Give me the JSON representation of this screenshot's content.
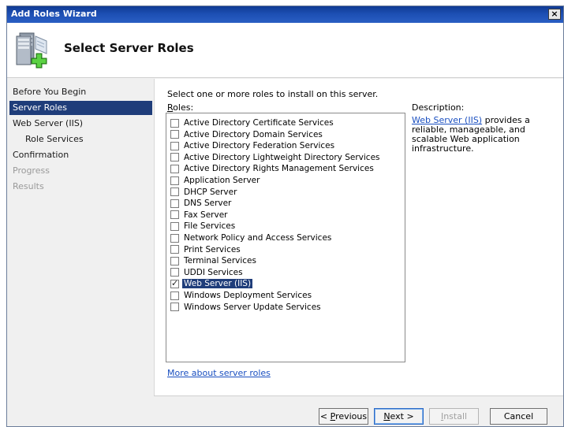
{
  "window": {
    "title": "Add Roles Wizard",
    "close_glyph": "×"
  },
  "header": {
    "title": "Select Server Roles",
    "icon": "server-add-icon"
  },
  "nav": {
    "items": [
      {
        "label": "Before You Begin",
        "state": "normal"
      },
      {
        "label": "Server Roles",
        "state": "active"
      },
      {
        "label": "Web Server (IIS)",
        "state": "normal"
      },
      {
        "label": "Role Services",
        "state": "sub"
      },
      {
        "label": "Confirmation",
        "state": "normal"
      },
      {
        "label": "Progress",
        "state": "disabled"
      },
      {
        "label": "Results",
        "state": "disabled"
      }
    ]
  },
  "main": {
    "instruction": "Select one or more roles to install on this server.",
    "roles_label_hotkey": "R",
    "roles_label_rest": "oles:",
    "description_label": "Description:",
    "description_link": "Web Server (IIS)",
    "description_text": " provides a reliable, manageable, and scalable Web application infrastructure.",
    "more_link": "More about server roles",
    "roles": [
      {
        "label": "Active Directory Certificate Services",
        "checked": false
      },
      {
        "label": "Active Directory Domain Services",
        "checked": false
      },
      {
        "label": "Active Directory Federation Services",
        "checked": false
      },
      {
        "label": "Active Directory Lightweight Directory Services",
        "checked": false
      },
      {
        "label": "Active Directory Rights Management Services",
        "checked": false
      },
      {
        "label": "Application Server",
        "checked": false
      },
      {
        "label": "DHCP Server",
        "checked": false
      },
      {
        "label": "DNS Server",
        "checked": false
      },
      {
        "label": "Fax Server",
        "checked": false
      },
      {
        "label": "File Services",
        "checked": false
      },
      {
        "label": "Network Policy and Access Services",
        "checked": false
      },
      {
        "label": "Print Services",
        "checked": false
      },
      {
        "label": "Terminal Services",
        "checked": false
      },
      {
        "label": "UDDI Services",
        "checked": false
      },
      {
        "label": "Web Server (IIS)",
        "checked": true,
        "selected": true
      },
      {
        "label": "Windows Deployment Services",
        "checked": false
      },
      {
        "label": "Windows Server Update Services",
        "checked": false
      }
    ]
  },
  "footer": {
    "previous": {
      "prefix": "< ",
      "hotkey": "P",
      "rest": "revious"
    },
    "next": {
      "hotkey": "N",
      "rest": "ext >"
    },
    "install": {
      "prefix": "",
      "hotkey": "I",
      "rest": "nstall"
    },
    "cancel": "Cancel"
  }
}
